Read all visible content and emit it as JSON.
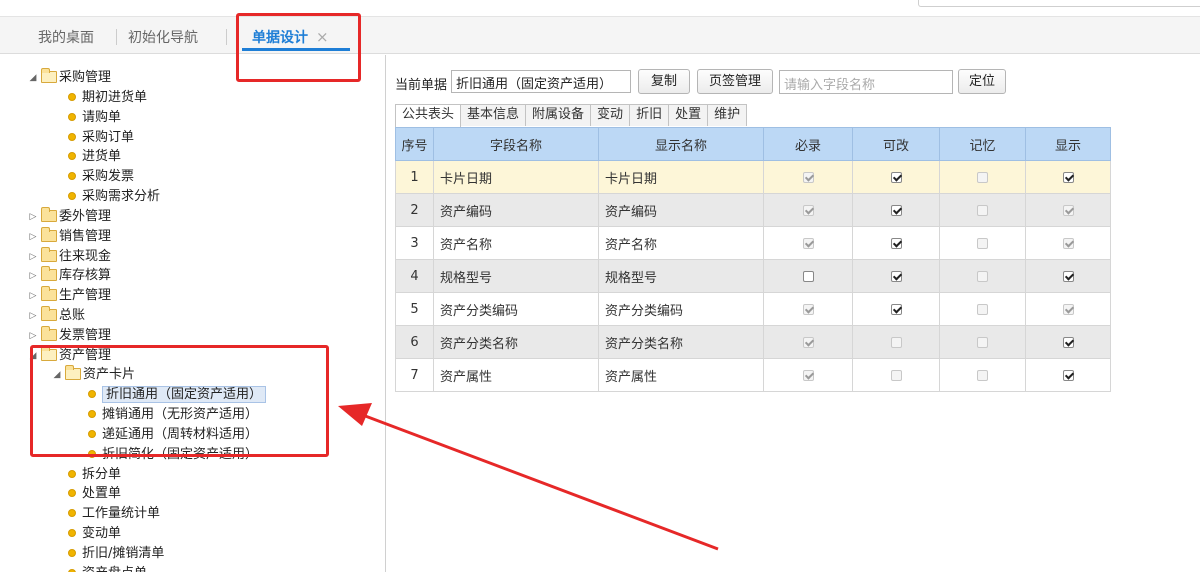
{
  "tabs": {
    "desktop": "我的桌面",
    "init_nav": "初始化导航",
    "active": "单据设计",
    "close": "×"
  },
  "tree": [
    {
      "label": "采购管理",
      "level": 0,
      "type": "folder",
      "open": true
    },
    {
      "label": "期初进货单",
      "level": 1,
      "type": "leaf"
    },
    {
      "label": "请购单",
      "level": 1,
      "type": "leaf"
    },
    {
      "label": "采购订单",
      "level": 1,
      "type": "leaf"
    },
    {
      "label": "进货单",
      "level": 1,
      "type": "leaf"
    },
    {
      "label": "采购发票",
      "level": 1,
      "type": "leaf"
    },
    {
      "label": "采购需求分析",
      "level": 1,
      "type": "leaf"
    },
    {
      "label": "委外管理",
      "level": 0,
      "type": "folder",
      "open": false
    },
    {
      "label": "销售管理",
      "level": 0,
      "type": "folder",
      "open": false
    },
    {
      "label": "往来现金",
      "level": 0,
      "type": "folder",
      "open": false
    },
    {
      "label": "库存核算",
      "level": 0,
      "type": "folder",
      "open": false
    },
    {
      "label": "生产管理",
      "level": 0,
      "type": "folder",
      "open": false
    },
    {
      "label": "总账",
      "level": 0,
      "type": "folder",
      "open": false
    },
    {
      "label": "发票管理",
      "level": 0,
      "type": "folder",
      "open": false
    },
    {
      "label": "资产管理",
      "level": 0,
      "type": "folder",
      "open": true
    },
    {
      "label": "资产卡片",
      "level": 1,
      "type": "folder",
      "open": true
    },
    {
      "label": "折旧通用（固定资产适用）",
      "level": 2,
      "type": "leaf",
      "selected": true
    },
    {
      "label": "摊销通用（无形资产适用）",
      "level": 2,
      "type": "leaf"
    },
    {
      "label": "递延通用（周转材料适用）",
      "level": 2,
      "type": "leaf"
    },
    {
      "label": "折旧简化（固定资产适用）",
      "level": 2,
      "type": "leaf"
    },
    {
      "label": "拆分单",
      "level": 1,
      "type": "leaf"
    },
    {
      "label": "处置单",
      "level": 1,
      "type": "leaf"
    },
    {
      "label": "工作量统计单",
      "level": 1,
      "type": "leaf"
    },
    {
      "label": "变动单",
      "level": 1,
      "type": "leaf"
    },
    {
      "label": "折旧/摊销清单",
      "level": 1,
      "type": "leaf"
    },
    {
      "label": "资产盘点单",
      "level": 1,
      "type": "leaf"
    }
  ],
  "toolbar": {
    "current_label": "当前单据",
    "current_value": "折旧通用（固定资产适用）",
    "copy": "复制",
    "page_manage": "页签管理",
    "search_placeholder": "请输入字段名称",
    "locate": "定位"
  },
  "subtabs": [
    "公共表头",
    "基本信息",
    "附属设备",
    "变动",
    "折旧",
    "处置",
    "维护"
  ],
  "grid": {
    "headers": [
      "序号",
      "字段名称",
      "显示名称",
      "必录",
      "可改",
      "记忆",
      "显示"
    ],
    "rows": [
      {
        "no": "1",
        "field": "卡片日期",
        "display": "卡片日期",
        "required": {
          "checked": true,
          "disabled": true
        },
        "editable": {
          "checked": true,
          "disabled": false
        },
        "memory": {
          "checked": false,
          "disabled": true
        },
        "show": {
          "checked": true,
          "disabled": false
        }
      },
      {
        "no": "2",
        "field": "资产编码",
        "display": "资产编码",
        "required": {
          "checked": true,
          "disabled": true
        },
        "editable": {
          "checked": true,
          "disabled": false
        },
        "memory": {
          "checked": false,
          "disabled": true
        },
        "show": {
          "checked": true,
          "disabled": true
        }
      },
      {
        "no": "3",
        "field": "资产名称",
        "display": "资产名称",
        "required": {
          "checked": true,
          "disabled": true
        },
        "editable": {
          "checked": true,
          "disabled": false
        },
        "memory": {
          "checked": false,
          "disabled": true
        },
        "show": {
          "checked": true,
          "disabled": true
        }
      },
      {
        "no": "4",
        "field": "规格型号",
        "display": "规格型号",
        "required": {
          "checked": false,
          "disabled": false
        },
        "editable": {
          "checked": true,
          "disabled": false
        },
        "memory": {
          "checked": false,
          "disabled": true
        },
        "show": {
          "checked": true,
          "disabled": false
        }
      },
      {
        "no": "5",
        "field": "资产分类编码",
        "display": "资产分类编码",
        "required": {
          "checked": true,
          "disabled": true
        },
        "editable": {
          "checked": true,
          "disabled": false
        },
        "memory": {
          "checked": false,
          "disabled": true
        },
        "show": {
          "checked": true,
          "disabled": true
        }
      },
      {
        "no": "6",
        "field": "资产分类名称",
        "display": "资产分类名称",
        "required": {
          "checked": true,
          "disabled": true
        },
        "editable": {
          "checked": false,
          "disabled": true
        },
        "memory": {
          "checked": false,
          "disabled": true
        },
        "show": {
          "checked": true,
          "disabled": false
        }
      },
      {
        "no": "7",
        "field": "资产属性",
        "display": "资产属性",
        "required": {
          "checked": true,
          "disabled": true
        },
        "editable": {
          "checked": false,
          "disabled": true
        },
        "memory": {
          "checked": false,
          "disabled": true
        },
        "show": {
          "checked": true,
          "disabled": false
        }
      }
    ]
  },
  "colors": {
    "accent": "#1e7ed6",
    "highlight": "#e62828",
    "header_bg": "#bcd8f5",
    "selected_row": "#fdf6d8"
  }
}
